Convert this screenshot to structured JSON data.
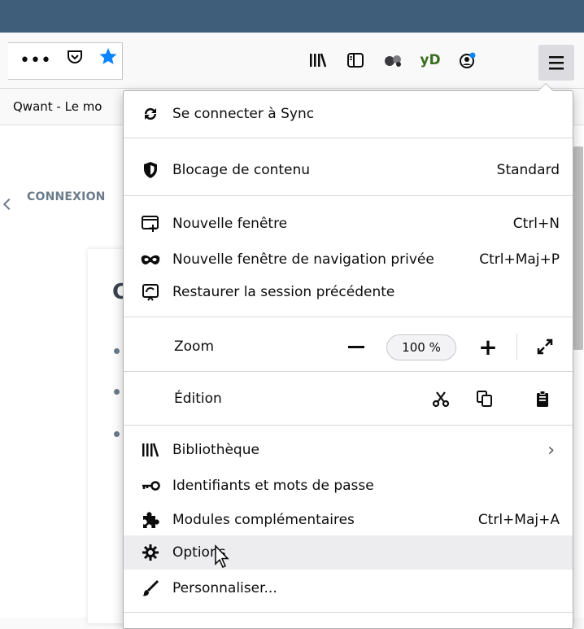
{
  "toolbar": {
    "page_actions": [
      "•••",
      "⊡",
      "★"
    ],
    "icons": [
      "library-icon",
      "sidebar-icon",
      "extension-blue-icon",
      "yandex-icon",
      "account-icon"
    ],
    "yd_label": "yD",
    "accent": "#0a84ff"
  },
  "bookmarks": {
    "item_label": "Qwant - Le mo"
  },
  "page": {
    "nav_label": "CONNEXION",
    "card_glyph": "C"
  },
  "app_menu": {
    "sync_label": "Se connecter à Sync",
    "content_blocking": {
      "label": "Blocage de contenu",
      "value": "Standard"
    },
    "new_window": {
      "label": "Nouvelle fenêtre",
      "shortcut": "Ctrl+N"
    },
    "private_window": {
      "label": "Nouvelle fenêtre de navigation privée",
      "shortcut": "Ctrl+Maj+P"
    },
    "restore_session": {
      "label": "Restaurer la session précédente"
    },
    "zoom": {
      "label": "Zoom",
      "level": "100 %"
    },
    "edit": {
      "label": "Édition"
    },
    "library": {
      "label": "Bibliothèque"
    },
    "logins": {
      "label": "Identifiants et mots de passe"
    },
    "addons": {
      "label": "Modules complémentaires",
      "shortcut": "Ctrl+Maj+A"
    },
    "options": {
      "label": "Options"
    },
    "customize": {
      "label": "Personnaliser..."
    }
  },
  "colors": {
    "titlebar": "#3f5e7a",
    "hover": "#ededf0",
    "menu_border": "#b1b1b3"
  }
}
